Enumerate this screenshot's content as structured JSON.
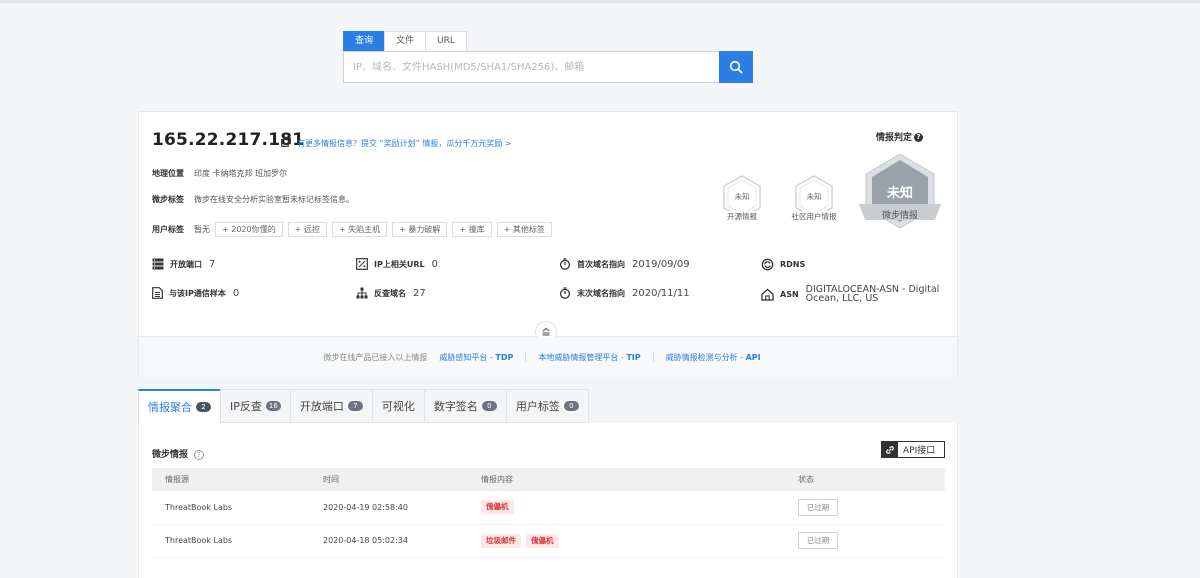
{
  "search": {
    "tabs": [
      {
        "label": "查询",
        "active": true
      },
      {
        "label": "文件",
        "active": false
      },
      {
        "label": "URL",
        "active": false
      }
    ],
    "placeholder": "IP、域名、文件HASH(MD5/SHA1/SHA256)、邮箱"
  },
  "ip": {
    "address": "165.22.217.181",
    "promo": "有更多情报信息？提交 “奖励计划” 情报，瓜分千万元奖励 >",
    "verdict_label": "情报判定",
    "location_label": "地理位置",
    "location_value": "印度 卡纳塔克邦 班加罗尔",
    "tag_label": "微步标签",
    "tag_value": "微步在线安全分析实验室暂未标记标签信息。",
    "user_tag_label": "用户标签",
    "user_tag_value": "暂无",
    "user_tags": [
      "+ 2020你懂的",
      "+ 远控",
      "+ 失陷主机",
      "+ 暴力破解",
      "+ 撞库",
      "+ 其他标签"
    ]
  },
  "badges": {
    "open_source": {
      "status": "未知",
      "name": "开源情报"
    },
    "community": {
      "status": "未知",
      "name": "社区用户情报"
    },
    "threatbook": {
      "status": "未知",
      "name": "微步情报"
    }
  },
  "stats": {
    "open_ports": {
      "label": "开放端口",
      "value": "7"
    },
    "related_url": {
      "label": "IP上相关URL",
      "value": "0"
    },
    "first_seen": {
      "label": "首次域名指向",
      "value": "2019/09/09"
    },
    "rdns": {
      "label": "RDNS",
      "value": ""
    },
    "samples": {
      "label": "与该IP通信样本",
      "value": "0"
    },
    "reverse_domains": {
      "label": "反查域名",
      "value": "27"
    },
    "last_seen": {
      "label": "末次域名指向",
      "value": "2020/11/11"
    },
    "asn": {
      "label": "ASN",
      "value": "DIGITALOCEAN-ASN - Digital Ocean, LLC, US"
    }
  },
  "footer": {
    "text": "微步在线产品已接入以上情报",
    "links": [
      {
        "pre": "威胁感知平台 - ",
        "bold": "TDP"
      },
      {
        "pre": "本地威胁情报管理平台 - ",
        "bold": "TIP"
      },
      {
        "pre": "威胁情报检测与分析 - ",
        "bold": "API"
      }
    ]
  },
  "tabs": [
    {
      "label": "情报聚合",
      "count": "2",
      "active": true
    },
    {
      "label": "IP反查",
      "count": "16",
      "active": false
    },
    {
      "label": "开放端口",
      "count": "7",
      "active": false
    },
    {
      "label": "可视化",
      "count": "",
      "active": false
    },
    {
      "label": "数字签名",
      "count": "0",
      "active": false
    },
    {
      "label": "用户标签",
      "count": "0",
      "active": false
    }
  ],
  "panel": {
    "title": "微步情报",
    "api_label": "API接口",
    "columns": [
      "情报源",
      "时间",
      "情报内容",
      "状态"
    ],
    "rows": [
      {
        "source": "ThreatBook Labs",
        "time": "2020-04-19 02:58:40",
        "tags": [
          "傀儡机"
        ],
        "status": "已过期"
      },
      {
        "source": "ThreatBook Labs",
        "time": "2020-04-18 05:02:34",
        "tags": [
          "垃圾邮件",
          "傀儡机"
        ],
        "status": "已过期"
      }
    ]
  },
  "colors": {
    "accent": "#2b7ee4",
    "danger": "#d9363e"
  }
}
